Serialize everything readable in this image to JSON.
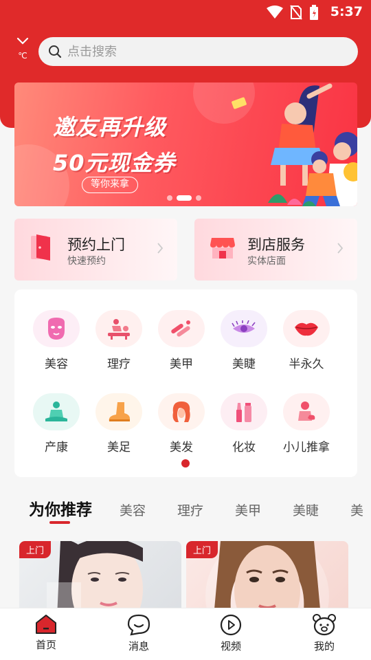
{
  "status_bar": {
    "time": "5:37"
  },
  "location": {
    "unit": "℃"
  },
  "search": {
    "placeholder": "点击搜索"
  },
  "banner": {
    "line1": "邀友再升级",
    "line2": "50元现金券",
    "pill": "等你来拿",
    "page_count": 3,
    "active_page": 2
  },
  "services": [
    {
      "title": "预约上门",
      "subtitle": "快速预约",
      "icon": "door-icon"
    },
    {
      "title": "到店服务",
      "subtitle": "实体店面",
      "icon": "storefront-icon"
    }
  ],
  "categories": [
    {
      "label": "美容",
      "icon": "face-mask-icon"
    },
    {
      "label": "理疗",
      "icon": "massage-icon"
    },
    {
      "label": "美甲",
      "icon": "nail-brush-icon"
    },
    {
      "label": "美睫",
      "icon": "eyelash-icon"
    },
    {
      "label": "半永久",
      "icon": "lips-icon"
    },
    {
      "label": "产康",
      "icon": "meditation-icon"
    },
    {
      "label": "美足",
      "icon": "foot-icon"
    },
    {
      "label": "美发",
      "icon": "hair-icon"
    },
    {
      "label": "化妆",
      "icon": "makeup-icon"
    },
    {
      "label": "小儿推拿",
      "icon": "baby-massage-icon"
    }
  ],
  "tabs": [
    {
      "label": "为你推荐",
      "active": true
    },
    {
      "label": "美容",
      "active": false
    },
    {
      "label": "理疗",
      "active": false
    },
    {
      "label": "美甲",
      "active": false
    },
    {
      "label": "美睫",
      "active": false
    },
    {
      "label": "美",
      "active": false
    }
  ],
  "products": [
    {
      "tag": "上门"
    },
    {
      "tag": "上门"
    }
  ],
  "bottom_nav": [
    {
      "label": "首页",
      "icon": "home-icon",
      "active": true
    },
    {
      "label": "消息",
      "icon": "message-icon",
      "active": false
    },
    {
      "label": "视频",
      "icon": "video-play-icon",
      "active": false
    },
    {
      "label": "我的",
      "icon": "bear-profile-icon",
      "active": false
    }
  ],
  "colors": {
    "brand_red": "#e02a2a",
    "accent_red": "#d8262c",
    "page_bg": "#f6f6f6"
  }
}
